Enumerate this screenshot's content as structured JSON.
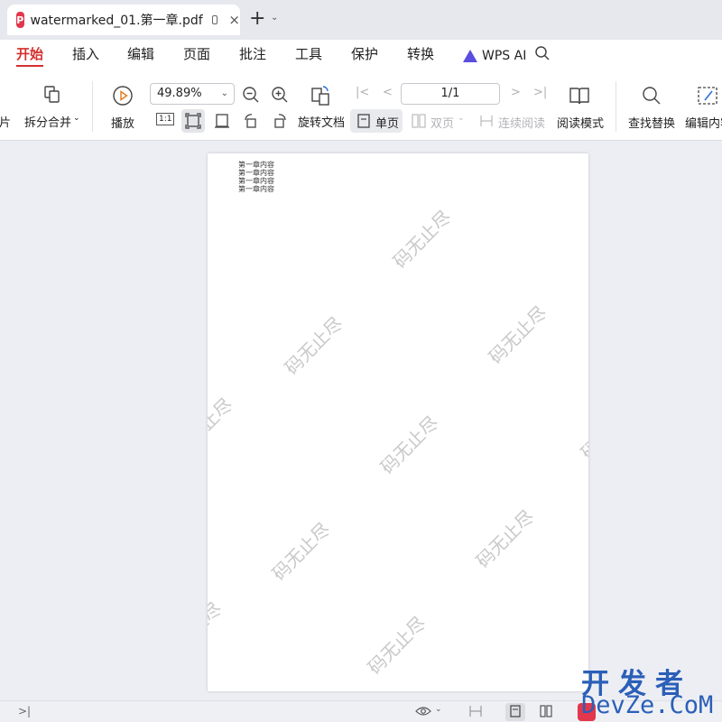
{
  "title_bar": {
    "tab_title": "watermarked_01.第一章.pdf",
    "pdf_logo_letter": "P",
    "close_symbol": "×",
    "new_tab_symbol": "+",
    "new_tab_dropdown": "⌄"
  },
  "menu": {
    "items": [
      "开始",
      "插入",
      "编辑",
      "页面",
      "批注",
      "工具",
      "保护",
      "转换"
    ],
    "active": "开始",
    "wps_ai": "WPS AI"
  },
  "toolbar": {
    "left_partial": "图片",
    "split_merge": "拆分合并",
    "play": "播放",
    "zoom": "49.89%",
    "actual_size": "1:1",
    "rotate_doc": "旋转文档",
    "page_indicator": "1/1",
    "single_page": "单页",
    "double_page": "双页",
    "continuous": "连续阅读",
    "read_mode": "阅读模式",
    "find_replace": "查找替换",
    "edit_content": "编辑内容"
  },
  "document": {
    "lines": [
      "第一章内容",
      "第一章内容",
      "第一章内容",
      "第一章内容"
    ],
    "watermark_text": "码无止尽"
  },
  "site_watermark": {
    "cn": "开发者",
    "en": "DevZe.CoM"
  },
  "colors": {
    "accent": "#d43030",
    "pdf_logo": "#e2374c",
    "wps_ai": "#5a4de0",
    "watermark": "#c9c9c9",
    "site": "#2b5fb8"
  }
}
